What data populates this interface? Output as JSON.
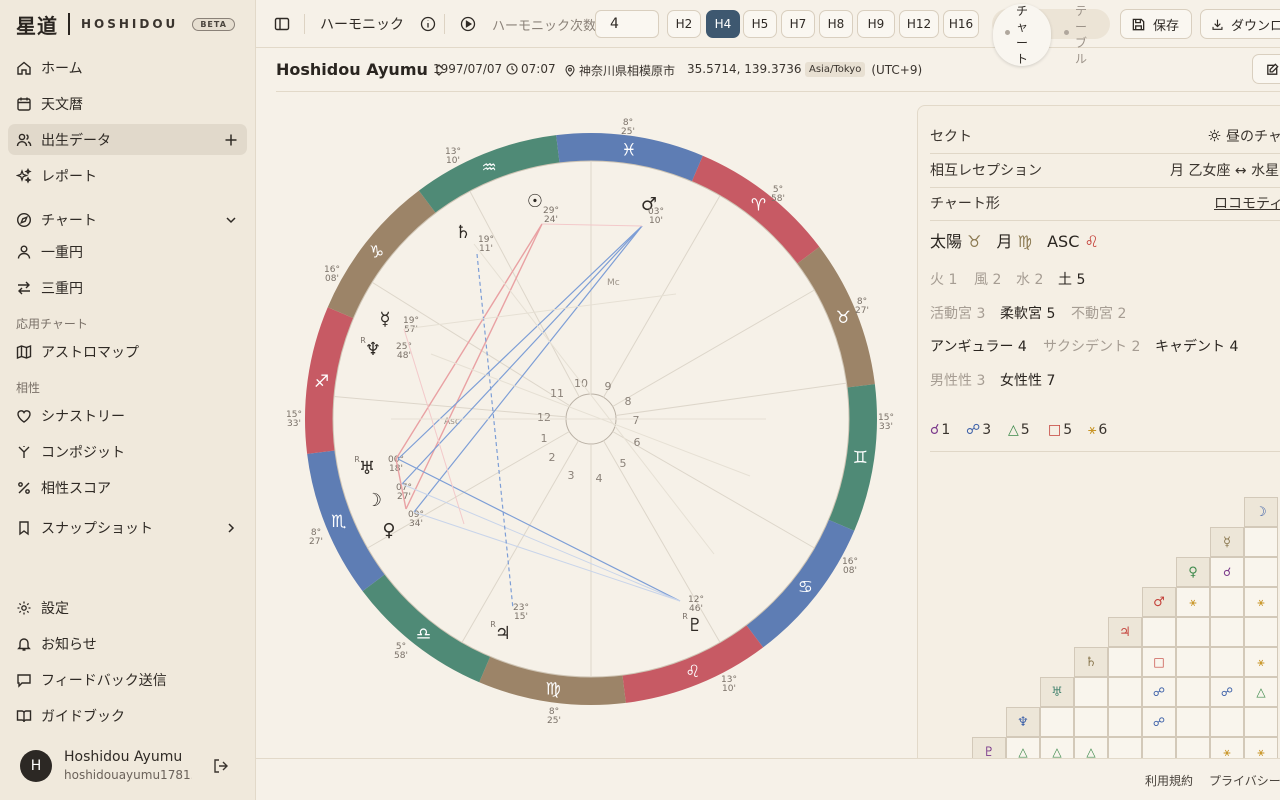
{
  "brand": {
    "kanji": "星道",
    "name": "HOSHIDOU",
    "badge": "BETA"
  },
  "sidebar": {
    "items": [
      {
        "label": "ホーム",
        "icon": "home-icon"
      },
      {
        "label": "天文暦",
        "icon": "calendar-icon"
      },
      {
        "label": "出生データ",
        "icon": "users-icon"
      },
      {
        "label": "レポート",
        "icon": "sparkles-icon"
      },
      {
        "label": "チャート",
        "icon": "compass-icon"
      },
      {
        "label": "一重円",
        "icon": "user-icon"
      },
      {
        "label": "三重円",
        "icon": "arrows-icon"
      },
      {
        "label": "アストロマップ",
        "icon": "map-icon"
      },
      {
        "label": "シナストリー",
        "icon": "heart-icon"
      },
      {
        "label": "コンポジット",
        "icon": "merge-icon"
      },
      {
        "label": "相性スコア",
        "icon": "percent-icon"
      },
      {
        "label": "スナップショット",
        "icon": "bookmark-icon"
      },
      {
        "label": "設定",
        "icon": "gear-icon"
      },
      {
        "label": "お知らせ",
        "icon": "bell-icon"
      },
      {
        "label": "フィードバック送信",
        "icon": "message-icon"
      },
      {
        "label": "ガイドブック",
        "icon": "book-icon"
      }
    ],
    "section_applied": "応用チャート",
    "section_compat": "相性"
  },
  "profile": {
    "initial": "H",
    "name": "Hoshidou Ayumu",
    "email": "hoshidouayumu1781..."
  },
  "toolbar": {
    "mode_label": "ハーモニック",
    "order_label": "ハーモニック次数",
    "order_value": "4",
    "harmonics": [
      "H2",
      "H4",
      "H5",
      "H7",
      "H8",
      "H9",
      "H12",
      "H16"
    ],
    "active_harmonic": "H4",
    "view_chart": "チャート",
    "view_table": "テーブル",
    "save_label": "保存",
    "download_label": "ダウンロード"
  },
  "info": {
    "name": "Hoshidou Ayumu",
    "date": "1997/07/07",
    "time": "07:07",
    "place": "神奈川県相模原市",
    "coords": "35.5714, 139.3736",
    "tz": "Asia/Tokyo",
    "offset": "(UTC+9)"
  },
  "wheel": {
    "sign_colors": {
      "fire": "#c75a64",
      "earth": "#9c8468",
      "air": "#4f8a76",
      "water": "#5e7db4"
    },
    "houses": [
      "1",
      "2",
      "3",
      "4",
      "5",
      "6",
      "7",
      "8",
      "9",
      "10",
      "11",
      "12"
    ],
    "cusp_labels": [
      {
        "deg": "8°",
        "min": "25'"
      },
      {
        "deg": "5°",
        "min": "58'"
      },
      {
        "deg": "8°",
        "min": "27'"
      },
      {
        "deg": "15°",
        "min": "33'"
      },
      {
        "deg": "16°",
        "min": "08'"
      },
      {
        "deg": "13°",
        "min": "10'"
      },
      {
        "deg": "8°",
        "min": "25'"
      },
      {
        "deg": "5°",
        "min": "58'"
      },
      {
        "deg": "8°",
        "min": "27'"
      },
      {
        "deg": "15°",
        "min": "33'"
      },
      {
        "deg": "16°",
        "min": "08'"
      },
      {
        "deg": "13°",
        "min": "10'"
      }
    ],
    "planets": [
      {
        "glyph": "☉",
        "deg": "29°",
        "min": "24'"
      },
      {
        "glyph": "♂",
        "deg": "03°",
        "min": "10'"
      },
      {
        "glyph": "♄",
        "deg": "19°",
        "min": "11'"
      },
      {
        "glyph": "☿",
        "deg": "19°",
        "min": "57'"
      },
      {
        "glyph": "♆",
        "deg": "25°",
        "min": "48'",
        "retro": "R"
      },
      {
        "glyph": "♅",
        "deg": "00°",
        "min": "18'",
        "retro": "R"
      },
      {
        "glyph": "☽",
        "deg": "07°",
        "min": "27'"
      },
      {
        "glyph": "♀",
        "deg": "09°",
        "min": "34'"
      },
      {
        "glyph": "♃",
        "deg": "23°",
        "min": "15'",
        "retro": "R"
      },
      {
        "glyph": "♇",
        "deg": "12°",
        "min": "46'",
        "retro": "R"
      }
    ],
    "angles": {
      "mc": "Mc",
      "asc": "Asc"
    }
  },
  "panel": {
    "sect_label": "セクト",
    "sect_value": "昼のチャート",
    "reception_label": "相互レセプション",
    "reception_value": "月 乙女座 ↔ 水星",
    "shape_label": "チャート形",
    "shape_value": "ロコモティブ",
    "big3": {
      "sun": "太陽",
      "sun_sign": "♉",
      "moon": "月",
      "moon_sign": "♍",
      "asc": "ASC",
      "asc_sign": "♌"
    },
    "elements": [
      {
        "label": "火 1",
        "dim": true
      },
      {
        "label": "風 2",
        "dim": true
      },
      {
        "label": "水 2",
        "dim": true
      },
      {
        "label": "土 5",
        "dim": false
      }
    ],
    "modes": [
      {
        "label": "活動宮 3",
        "dim": true
      },
      {
        "label": "柔軟宮 5",
        "dim": false
      },
      {
        "label": "不動宮 2",
        "dim": true
      }
    ],
    "houses": [
      {
        "label": "アンギュラー 4",
        "dim": false
      },
      {
        "label": "サクシデント 2",
        "dim": true
      },
      {
        "label": "キャデント 4",
        "dim": false
      }
    ],
    "polarity": [
      {
        "label": "男性性 3",
        "dim": true
      },
      {
        "label": "女性性 7",
        "dim": false
      }
    ],
    "aspects": [
      {
        "glyph": "☌",
        "count": "1",
        "color": "#7b3a8c"
      },
      {
        "glyph": "☍",
        "count": "3",
        "color": "#3b5fa8"
      },
      {
        "glyph": "△",
        "count": "5",
        "color": "#3e8a4c"
      },
      {
        "glyph": "□",
        "count": "5",
        "color": "#c4423b"
      },
      {
        "glyph": "⚹",
        "count": "6",
        "color": "#c89424"
      }
    ]
  },
  "grid": {
    "planets": [
      "☽",
      "☿",
      "♀",
      "♂",
      "♃",
      "♄",
      "♅",
      "♆",
      "♇"
    ],
    "cells": [
      {
        "r": 2,
        "c": 1,
        "g": "☌",
        "col": "#7b3a8c"
      },
      {
        "r": 3,
        "c": 0,
        "g": "⚹",
        "col": "#c89424"
      },
      {
        "r": 3,
        "c": 2,
        "g": "⚹",
        "col": "#c89424"
      },
      {
        "r": 5,
        "c": 0,
        "g": "⚹",
        "col": "#c89424"
      },
      {
        "r": 5,
        "c": 3,
        "g": "□",
        "col": "#c4423b"
      },
      {
        "r": 6,
        "c": 0,
        "g": "△",
        "col": "#3e8a4c"
      },
      {
        "r": 6,
        "c": 1,
        "g": "☍",
        "col": "#3b5fa8"
      },
      {
        "r": 6,
        "c": 3,
        "g": "☍",
        "col": "#3b5fa8"
      },
      {
        "r": 7,
        "c": 3,
        "g": "☍",
        "col": "#3b5fa8"
      },
      {
        "r": 8,
        "c": 0,
        "g": "⚹",
        "col": "#c89424"
      },
      {
        "r": 8,
        "c": 1,
        "g": "⚹",
        "col": "#c89424"
      },
      {
        "r": 8,
        "c": 5,
        "g": "△",
        "col": "#3e8a4c"
      },
      {
        "r": 8,
        "c": 6,
        "g": "△",
        "col": "#3e8a4c"
      },
      {
        "r": 8,
        "c": 7,
        "g": "△",
        "col": "#3e8a4c"
      }
    ]
  },
  "footer": {
    "terms": "利用規約",
    "privacy": "プライバシー"
  }
}
